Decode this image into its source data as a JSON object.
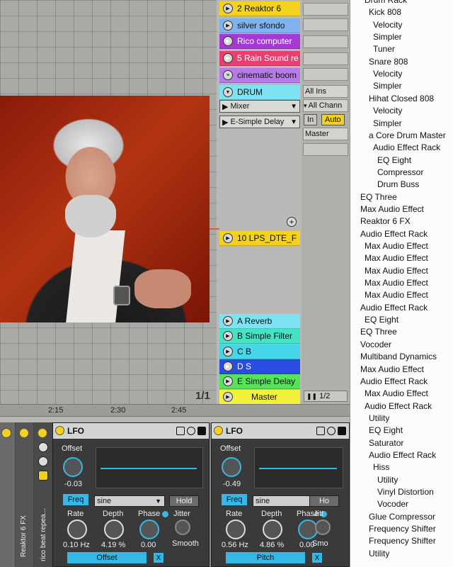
{
  "tracks": [
    {
      "label": "2 Reaktor 6",
      "color": "#f2d21f",
      "icon": "play-icon"
    },
    {
      "label": "silver sfondo",
      "color": "#7fb3ef",
      "icon": "play-icon"
    },
    {
      "label": "Rico computer",
      "color": "#a43ad1",
      "icon": "play-icon"
    },
    {
      "label": "5 Rain Sound re",
      "color": "#ea3d70",
      "icon": "play-icon"
    },
    {
      "label": "cinematic boom",
      "color": "#b67be8",
      "icon": "menu-icon"
    },
    {
      "label": "DRUM",
      "color": "#7de3f2",
      "icon": "chevron-down-icon"
    }
  ],
  "drum_devices": [
    "Mixer",
    "E-Simple Delay"
  ],
  "io": {
    "input": "All Ins",
    "channel": "All Chann",
    "in_label": "In",
    "auto_label": "Auto",
    "output": "Master"
  },
  "track_10": {
    "label": "10 LPS_DTE_F",
    "color": "#f2d21f",
    "icon": "play-icon"
  },
  "returns": [
    {
      "label": "A Reverb",
      "color": "#7de3f2",
      "icon": "play-icon"
    },
    {
      "label": "B Simple Filter",
      "color": "#45e3c3",
      "icon": "play-icon"
    },
    {
      "label": "C B",
      "color": "#45d6ea",
      "icon": "play-icon"
    },
    {
      "label": "D S",
      "color": "#2a4ce0",
      "icon": "play-icon"
    },
    {
      "label": "E Simple Delay",
      "color": "#56e35a",
      "icon": "play-icon"
    }
  ],
  "master": {
    "label": "Master",
    "color": "#f2f23a",
    "icon": "play-icon"
  },
  "page_indicator": "1/1",
  "master_ratio": "1/2",
  "timeline": [
    "2:15",
    "2:30",
    "2:45"
  ],
  "side_labels": [
    "Reaktor 6 FX",
    "rico beat repea..."
  ],
  "lfos": [
    {
      "title": "LFO",
      "offset_label": "Offset",
      "offset_value": "-0.03",
      "freq": "Freq",
      "wave": "sine",
      "hold": "Hold",
      "rate_label": "Rate",
      "rate": "0.10 Hz",
      "depth_label": "Depth",
      "depth": "4.19 %",
      "phase_label": "Phase",
      "phase": "0.00",
      "jitter_label": "Jitter",
      "smooth_label": "Smooth",
      "map_target": "Offset",
      "x": "X"
    },
    {
      "title": "LFO",
      "offset_label": "Offset",
      "offset_value": "-0.49",
      "freq": "Freq",
      "wave": "sine",
      "hold": "Ho",
      "rate_label": "Rate",
      "rate": "0.56 Hz",
      "depth_label": "Depth",
      "depth": "4.86 %",
      "phase_label": "Phase",
      "phase": "0.00",
      "jitter_label": "Jitt",
      "smooth_label": "Smo",
      "map_target": "Pitch",
      "x": "X"
    }
  ],
  "menu": [
    {
      "label": "Drum Rack",
      "indent": 1
    },
    {
      "label": "Kick 808",
      "indent": 2
    },
    {
      "label": "Velocity",
      "indent": 3
    },
    {
      "label": "Simpler",
      "indent": 3
    },
    {
      "label": "Tuner",
      "indent": 3
    },
    {
      "label": "Snare 808",
      "indent": 2
    },
    {
      "label": "Velocity",
      "indent": 3
    },
    {
      "label": "Simpler",
      "indent": 3
    },
    {
      "label": "Hihat Closed 808",
      "indent": 2
    },
    {
      "label": "Velocity",
      "indent": 3
    },
    {
      "label": "Simpler",
      "indent": 3
    },
    {
      "label": "a Core Drum Master",
      "indent": 2
    },
    {
      "label": "Audio Effect Rack",
      "indent": 3
    },
    {
      "label": "EQ Eight",
      "indent": 4
    },
    {
      "label": "Compressor",
      "indent": 4
    },
    {
      "label": "Drum Buss",
      "indent": 4
    },
    {
      "label": "EQ Three",
      "indent": 0
    },
    {
      "label": "Max Audio Effect",
      "indent": 0
    },
    {
      "label": "Reaktor 6 FX",
      "indent": 0
    },
    {
      "label": "Audio Effect Rack",
      "indent": 0
    },
    {
      "label": "Max Audio Effect",
      "indent": 1
    },
    {
      "label": "Max Audio Effect",
      "indent": 1
    },
    {
      "label": "Max Audio Effect",
      "indent": 1
    },
    {
      "label": "Max Audio Effect",
      "indent": 1
    },
    {
      "label": "Max Audio Effect",
      "indent": 1
    },
    {
      "label": "Audio Effect Rack",
      "indent": 0
    },
    {
      "label": "EQ Eight",
      "indent": 1
    },
    {
      "label": "EQ Three",
      "indent": 0
    },
    {
      "label": "Vocoder",
      "indent": 0
    },
    {
      "label": "Multiband Dynamics",
      "indent": 0
    },
    {
      "label": "Max Audio Effect",
      "indent": 0
    },
    {
      "label": "Audio Effect Rack",
      "indent": 0
    },
    {
      "label": "Max Audio Effect",
      "indent": 1
    },
    {
      "label": "Audio Effect Rack",
      "indent": 1
    },
    {
      "label": "Utility",
      "indent": 2
    },
    {
      "label": "EQ Eight",
      "indent": 2
    },
    {
      "label": "Saturator",
      "indent": 2
    },
    {
      "label": "Audio Effect Rack",
      "indent": 2
    },
    {
      "label": "Hiss",
      "indent": 3
    },
    {
      "label": "Utility",
      "indent": 4
    },
    {
      "label": "Vinyl Distortion",
      "indent": 4
    },
    {
      "label": "Vocoder",
      "indent": 4
    },
    {
      "label": "Glue Compressor",
      "indent": 2
    },
    {
      "label": "Frequency Shifter",
      "indent": 2
    },
    {
      "label": "Frequency Shifter",
      "indent": 2
    },
    {
      "label": "Utility",
      "indent": 2
    }
  ]
}
